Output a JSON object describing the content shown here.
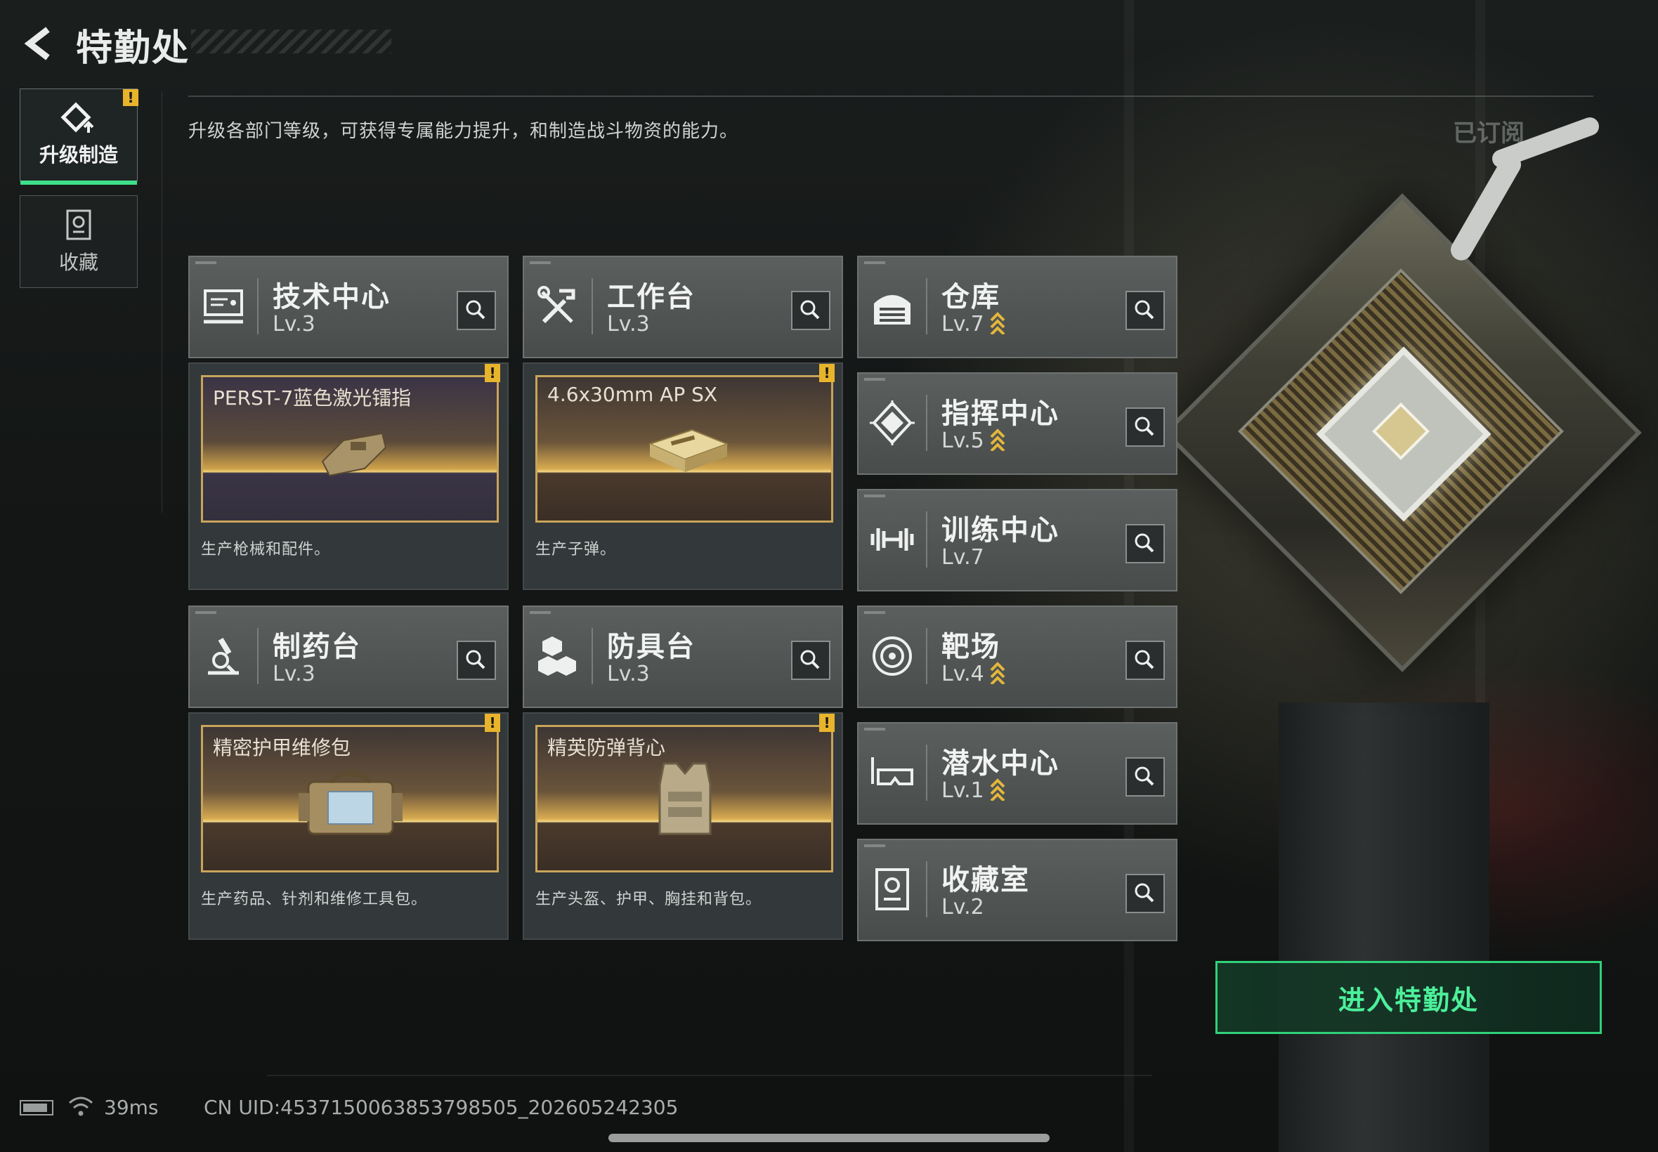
{
  "header": {
    "title": "特勤处",
    "description": "升级各部门等级，可获得专属能力提升，和制造战斗物资的能力。",
    "subscribed_label": "已订阅"
  },
  "tabs": [
    {
      "label": "升级制造",
      "active": true,
      "icon": "upgrade-diamond-icon",
      "warning": "!"
    },
    {
      "label": "收藏",
      "active": false,
      "icon": "collection-icon"
    }
  ],
  "departments": [
    {
      "name": "技术中心",
      "level": "Lv.3",
      "icon": "monitor-icon",
      "level_up": false,
      "product": {
        "name": "PERST-7蓝色激光镭指",
        "desc": "生产枪械和配件。",
        "warning": "!"
      }
    },
    {
      "name": "工作台",
      "level": "Lv.3",
      "icon": "tools-icon",
      "level_up": false,
      "product": {
        "name": "4.6x30mm AP SX",
        "desc": "生产子弹。",
        "warning": "!"
      }
    },
    {
      "name": "制药台",
      "level": "Lv.3",
      "icon": "microscope-icon",
      "level_up": false,
      "product": {
        "name": "精密护甲维修包",
        "desc": "生产药品、针剂和维修工具包。",
        "warning": "!"
      }
    },
    {
      "name": "防具台",
      "level": "Lv.3",
      "icon": "armor-crates-icon",
      "level_up": false,
      "product": {
        "name": "精英防弹背心",
        "desc": "生产头盔、护甲、胸挂和背包。",
        "warning": "!"
      }
    }
  ],
  "right_departments": [
    {
      "name": "仓库",
      "level": "Lv.7",
      "icon": "warehouse-icon",
      "level_up": true
    },
    {
      "name": "指挥中心",
      "level": "Lv.5",
      "icon": "command-chip-icon",
      "level_up": true
    },
    {
      "name": "训练中心",
      "level": "Lv.7",
      "icon": "dumbbell-icon",
      "level_up": false
    },
    {
      "name": "靶场",
      "level": "Lv.4",
      "icon": "target-icon",
      "level_up": true
    },
    {
      "name": "潜水中心",
      "level": "Lv.1",
      "icon": "diving-mask-icon",
      "level_up": true
    },
    {
      "name": "收藏室",
      "level": "Lv.2",
      "icon": "collection-room-icon",
      "level_up": false
    }
  ],
  "enter_button": {
    "label": "进入特勤处"
  },
  "status": {
    "ping": "39ms",
    "uid": "CN UID:4537150063853798505_202605242305"
  },
  "colors": {
    "accent_green": "#3fe08a",
    "warning_yellow": "#e8b42c",
    "product_gold": "#c9a45a"
  }
}
